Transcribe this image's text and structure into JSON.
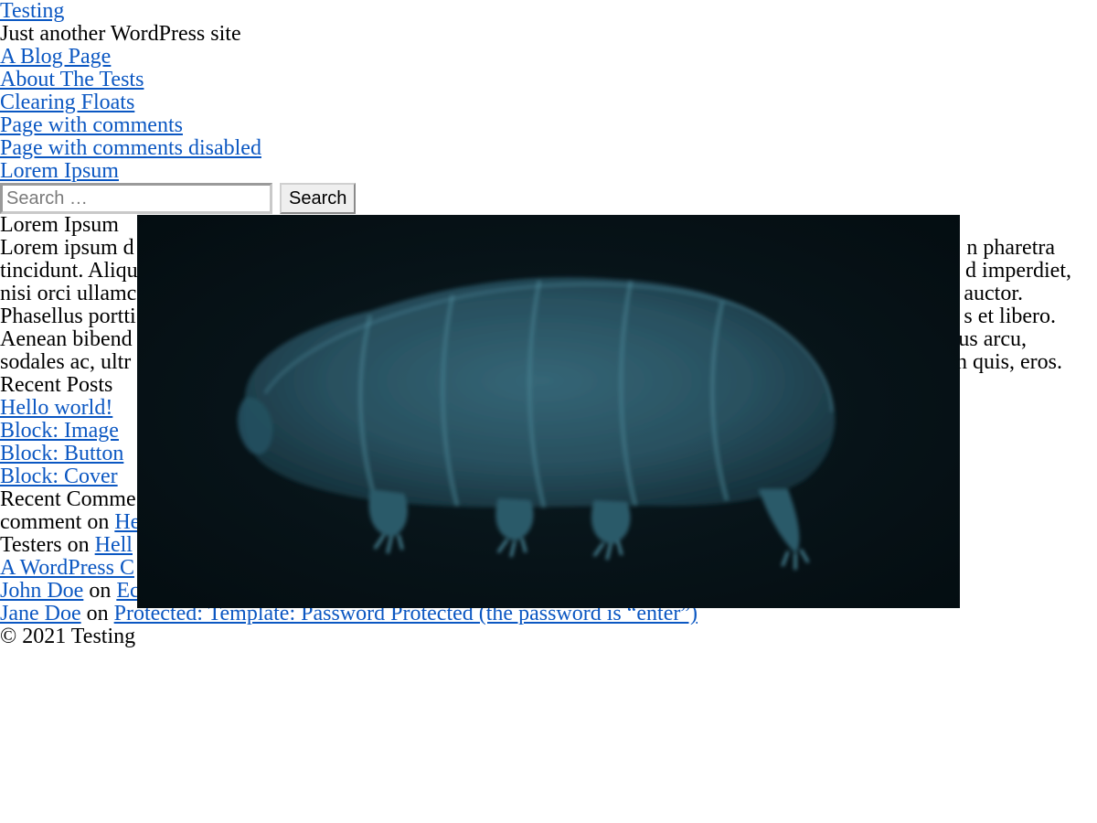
{
  "site": {
    "title": "Testing",
    "tagline": "Just another WordPress site"
  },
  "nav": {
    "items": [
      {
        "label": "A Blog Page"
      },
      {
        "label": "About The Tests"
      },
      {
        "label": "Clearing Floats"
      },
      {
        "label": "Page with comments"
      },
      {
        "label": "Page with comments disabled"
      },
      {
        "label": "Lorem Ipsum"
      }
    ]
  },
  "search": {
    "placeholder": "Search …",
    "value": "",
    "button_label": "Search"
  },
  "content": {
    "heading": "Lorem Ipsum",
    "lines": [
      {
        "start": "Lorem ipsum d",
        "end": "n pharetra"
      },
      {
        "start": "tincidunt. Aliqu",
        "end": "d imperdiet,"
      },
      {
        "start": "nisi orci ullamc",
        "end": "auctor."
      },
      {
        "start": "Phasellus portti",
        "end": "s et libero."
      },
      {
        "start": "Aenean bibend",
        "end": "us arcu,"
      },
      {
        "start": "sodales ac, ultr",
        "end": "n quis, eros."
      }
    ]
  },
  "recent_posts": {
    "heading": "Recent Posts",
    "items": [
      {
        "label": "Hello world!"
      },
      {
        "label": "Block: Image"
      },
      {
        "label": "Block: Button"
      },
      {
        "label": "Block: Cover"
      }
    ]
  },
  "recent_comments": {
    "heading": "Recent Comme",
    "items": [
      {
        "author": "comment",
        "on": "on",
        "post": "He"
      },
      {
        "author": "Testers",
        "on": "on",
        "post": "Hell"
      },
      {
        "author": "A WordPress C",
        "on": "",
        "post": ""
      },
      {
        "author": "John Doe",
        "on": "on",
        "post": "Ec"
      },
      {
        "author": "Jane Doe",
        "on": "on",
        "post": "Protected: Template: Password Protected (the password is “enter”)"
      }
    ]
  },
  "footer": {
    "copyright": "© 2021 Testing"
  },
  "overlay_image": {
    "subject": "tardigrade-image",
    "background": "#061216",
    "tint": "#3f7486"
  }
}
